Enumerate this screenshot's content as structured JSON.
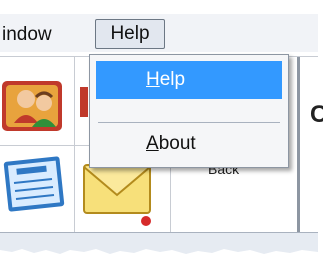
{
  "menubar": {
    "items": [
      {
        "label": "indow"
      },
      {
        "label": "Help"
      }
    ]
  },
  "help_menu": {
    "items": [
      {
        "label_mnemonic": "H",
        "label_rest": "elp",
        "selected": true
      },
      {
        "label_mnemonic": "A",
        "label_rest": "bout",
        "selected": false
      }
    ]
  },
  "toolbar": {
    "back_label": "Back",
    "right_letter": "C",
    "icons": [
      "users-icon",
      "invoice-icon",
      "email-icon"
    ]
  },
  "colors": {
    "selection": "#3399ff",
    "menubar_bg": "#f1f3f7",
    "menu_bg": "#f5f6f8"
  }
}
